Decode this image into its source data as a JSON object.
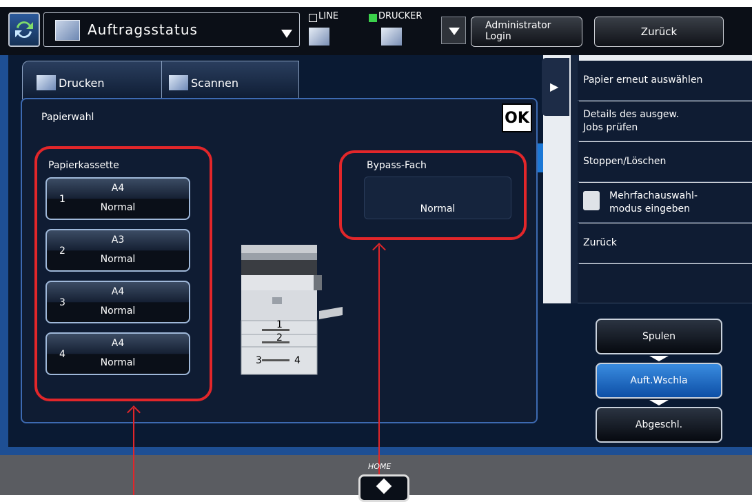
{
  "topbar": {
    "status_label": "Auftragsstatus",
    "line_label": "LINE",
    "printer_label": "DRUCKER",
    "admin_label_line1": "Administrator",
    "admin_label_line2": "Login",
    "back_label": "Zurück"
  },
  "tabs": [
    {
      "label": "Drucken"
    },
    {
      "label": "Scannen"
    }
  ],
  "dialog": {
    "title": "Papierwahl",
    "ok_label": "OK",
    "cassette_title": "Papierkassette",
    "trays": [
      {
        "num": "1",
        "size": "A4",
        "type": "Normal"
      },
      {
        "num": "2",
        "size": "A3",
        "type": "Normal"
      },
      {
        "num": "3",
        "size": "A4",
        "type": "Normal"
      },
      {
        "num": "4",
        "size": "A4",
        "type": "Normal"
      }
    ],
    "bypass_title": "Bypass-Fach",
    "bypass_type": "Normal",
    "copier_labels": [
      "1",
      "2",
      "3",
      "4"
    ]
  },
  "side_menu": {
    "items": [
      {
        "label": "Papier erneut auswählen"
      },
      {
        "label": "Details des ausgew.\nJobs prüfen"
      },
      {
        "label": "Stoppen/Löschen"
      },
      {
        "label": "Mehrfachauswahl-\nmodus eingeben"
      },
      {
        "label": "Zurück"
      }
    ]
  },
  "job_buttons": {
    "spool": "Spulen",
    "waiting": "Auft.Wschla",
    "done": "Abgeschl."
  },
  "home_label": "HOME",
  "colors": {
    "annotation_red": "#e2262a",
    "selected_blue": "#1c78d6",
    "screen_bg": "#0a1a33"
  }
}
